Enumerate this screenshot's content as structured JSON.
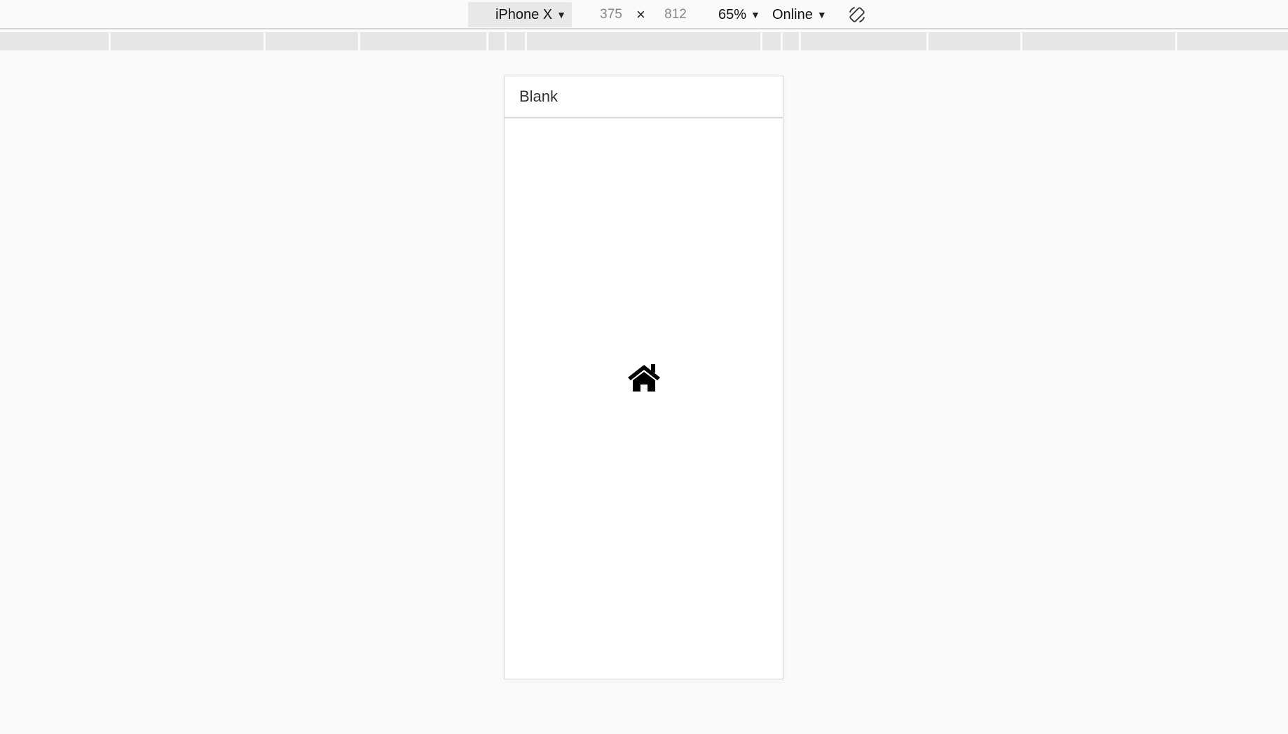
{
  "toolbar": {
    "device": "iPhone X",
    "width": "375",
    "height": "812",
    "times": "×",
    "zoom": "65%",
    "network": "Online",
    "icons": {
      "caret": "▼",
      "rotate": "rotate-icon"
    }
  },
  "app": {
    "header_title": "Blank",
    "center_icon": "home-icon"
  }
}
